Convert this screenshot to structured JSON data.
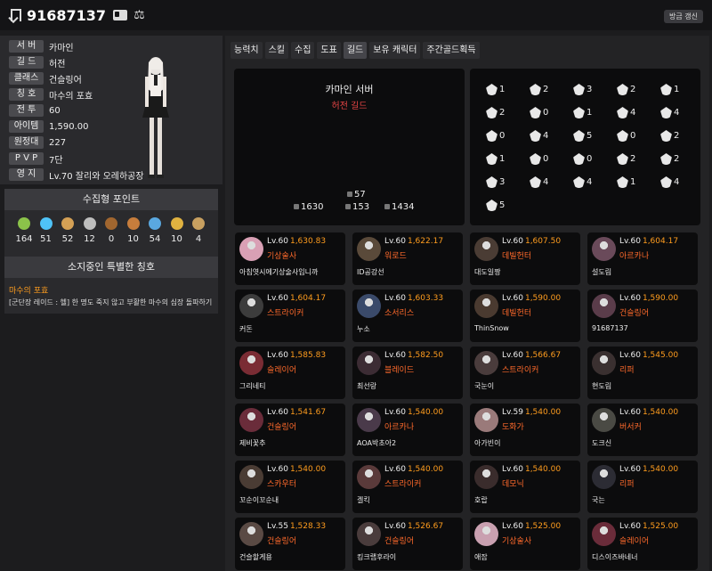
{
  "header": {
    "character_name": "91687137",
    "refresh_label": "방금 갱신"
  },
  "info": [
    {
      "label": "서 버",
      "value": "카마인"
    },
    {
      "label": "길 드",
      "value": "허전"
    },
    {
      "label": "클래스",
      "value": "건슬링어"
    },
    {
      "label": "칭 호",
      "value": "마수의 포효"
    },
    {
      "label": "전 투",
      "value": "60"
    },
    {
      "label": "아이템",
      "value": "1,590.00"
    },
    {
      "label": "원정대",
      "value": "227"
    },
    {
      "label": "P V P",
      "value": "7단"
    },
    {
      "label": "영 지",
      "value": "Lv.70 잘리와 오레하공장"
    }
  ],
  "collection": {
    "title": "수집형 포인트",
    "items": [
      {
        "icon": "mokoko-seed-icon",
        "count": "164",
        "color": "#8bc34a"
      },
      {
        "icon": "island-heart-icon",
        "count": "51",
        "color": "#4fc3f7"
      },
      {
        "icon": "great-art-icon",
        "count": "52",
        "color": "#d4a055"
      },
      {
        "icon": "giant-heart-icon",
        "count": "12",
        "color": "#bdbdbd"
      },
      {
        "icon": "ignea-token-icon",
        "count": "0",
        "color": "#a1662f"
      },
      {
        "icon": "sea-bounty-icon",
        "count": "10",
        "color": "#c77d3c"
      },
      {
        "icon": "world-tree-leaf-icon",
        "count": "54",
        "color": "#5aa8e0"
      },
      {
        "icon": "orpheus-star-icon",
        "count": "10",
        "color": "#e0b240"
      },
      {
        "icon": "omnium-star-icon",
        "count": "4",
        "color": "#c8a060"
      }
    ]
  },
  "special_titles": {
    "title": "소지중인 특별한 칭호",
    "name": "마수의 포효",
    "desc": "[군단장 레이드 : 헬] 한 명도 죽지 않고 부활한 마수의 심장 돌파하기"
  },
  "tabs": [
    "능력치",
    "스킬",
    "수집",
    "도표",
    "길드",
    "보유 캐릭터",
    "주간골드획득"
  ],
  "active_tab": "길드",
  "guild": {
    "server": "카마인 서버",
    "guild_name": "허전 길드",
    "members": "57",
    "stat1": "1630",
    "stat2": "153",
    "stat3": "1434"
  },
  "emblems": [
    "1",
    "2",
    "3",
    "2",
    "1",
    "2",
    "0",
    "1",
    "4",
    "4",
    "0",
    "4",
    "5",
    "0",
    "2",
    "1",
    "0",
    "0",
    "2",
    "2",
    "3",
    "4",
    "4",
    "1",
    "4",
    "5"
  ],
  "members": [
    {
      "lv": "Lv.60",
      "ilvl": "1,630.83",
      "cls": "기상술사",
      "name": "아침엿시에기상술사입니까",
      "color": "#d9a0b5"
    },
    {
      "lv": "Lv.60",
      "ilvl": "1,622.17",
      "cls": "워로드",
      "name": "ID공강선",
      "color": "#5a4a3a"
    },
    {
      "lv": "Lv.60",
      "ilvl": "1,607.50",
      "cls": "데빌헌터",
      "name": "대도일짱",
      "color": "#4a3c34"
    },
    {
      "lv": "Lv.60",
      "ilvl": "1,604.17",
      "cls": "아르카나",
      "name": "설도림",
      "color": "#6a4a5a"
    },
    {
      "lv": "Lv.60",
      "ilvl": "1,604.17",
      "cls": "스트라이커",
      "name": "커돈",
      "color": "#3c3c3c"
    },
    {
      "lv": "Lv.60",
      "ilvl": "1,603.33",
      "cls": "소서리스",
      "name": "누소",
      "color": "#3a4a6a"
    },
    {
      "lv": "Lv.60",
      "ilvl": "1,590.00",
      "cls": "데빌헌터",
      "name": "ThinSnow",
      "color": "#4a3a30"
    },
    {
      "lv": "Lv.60",
      "ilvl": "1,590.00",
      "cls": "건슬링어",
      "name": "91687137",
      "color": "#5a3c4a"
    },
    {
      "lv": "Lv.60",
      "ilvl": "1,585.83",
      "cls": "슬레이어",
      "name": "그리네티",
      "color": "#7a2c34"
    },
    {
      "lv": "Lv.60",
      "ilvl": "1,582.50",
      "cls": "블레이드",
      "name": "최선랑",
      "color": "#3c2c34"
    },
    {
      "lv": "Lv.60",
      "ilvl": "1,566.67",
      "cls": "스트라이커",
      "name": "국눈이",
      "color": "#4a3c3c"
    },
    {
      "lv": "Lv.60",
      "ilvl": "1,545.00",
      "cls": "리퍼",
      "name": "현도림",
      "color": "#3a3030"
    },
    {
      "lv": "Lv.60",
      "ilvl": "1,541.67",
      "cls": "건슬링어",
      "name": "제비꽃추",
      "color": "#6a2c3a"
    },
    {
      "lv": "Lv.60",
      "ilvl": "1,540.00",
      "cls": "아르카나",
      "name": "AOA박초아2",
      "color": "#4a3a4a"
    },
    {
      "lv": "Lv.59",
      "ilvl": "1,540.00",
      "cls": "도화가",
      "name": "아가빈이",
      "color": "#9a7a7a"
    },
    {
      "lv": "Lv.60",
      "ilvl": "1,540.00",
      "cls": "버서커",
      "name": "도크신",
      "color": "#4a4a44"
    },
    {
      "lv": "Lv.60",
      "ilvl": "1,540.00",
      "cls": "스카우터",
      "name": "꼬순이꼬순내",
      "color": "#4a3c34"
    },
    {
      "lv": "Lv.60",
      "ilvl": "1,540.00",
      "cls": "스트라이커",
      "name": "겔킥",
      "color": "#5a3a3a"
    },
    {
      "lv": "Lv.60",
      "ilvl": "1,540.00",
      "cls": "데모닉",
      "name": "호랍",
      "color": "#3a2c2c"
    },
    {
      "lv": "Lv.60",
      "ilvl": "1,540.00",
      "cls": "리퍼",
      "name": "국는",
      "color": "#2c2c34"
    },
    {
      "lv": "Lv.55",
      "ilvl": "1,528.33",
      "cls": "건슬링어",
      "name": "건슬할게용",
      "color": "#5a4a44"
    },
    {
      "lv": "Lv.60",
      "ilvl": "1,526.67",
      "cls": "건슬링어",
      "name": "킹크랩후라이",
      "color": "#4a3c3c"
    },
    {
      "lv": "Lv.60",
      "ilvl": "1,525.00",
      "cls": "기상술사",
      "name": "애잡",
      "color": "#c9a0b0"
    },
    {
      "lv": "Lv.60",
      "ilvl": "1,525.00",
      "cls": "슬레이어",
      "name": "디스이즈바네너",
      "color": "#6a2c3a"
    }
  ]
}
